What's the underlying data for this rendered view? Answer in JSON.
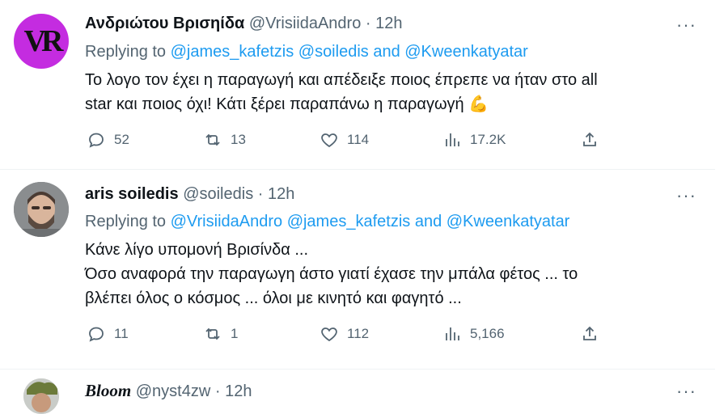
{
  "tweets": [
    {
      "name": "Ανδριώτου Βρισηίδα",
      "handle": "@VrisiidaAndro",
      "dot": "·",
      "time": "12h",
      "replying_prefix": "Replying to",
      "replying_mentions": "@james_kafetzis @soiledis and @Kweenkatyatar",
      "line1": "Το λογο τον έχει η παραγωγή και απέδειξε ποιος έπρεπε να ήταν στο all",
      "line2": "star και ποιος όχι! Κάτι ξέρει παραπάνω η παραγωγή 💪",
      "replies": "52",
      "retweets": "13",
      "likes": "114",
      "views": "17.2K"
    },
    {
      "name": "aris soiledis",
      "handle": "@soiledis",
      "dot": "·",
      "time": "12h",
      "replying_prefix": "Replying to",
      "replying_mentions": "@VrisiidaAndro @james_kafetzis and @Kweenkatyatar",
      "line1": "Κάνε λίγο υπομονή Βρισίνδα ...",
      "line2": "Όσο αναφορά την παραγωγη άστο γιατί έχασε την μπάλα φέτος ... το",
      "line3": "βλέπει όλος ο κόσμος ... όλοι με κινητό και φαγητό ...",
      "replies": "11",
      "retweets": "1",
      "likes": "112",
      "views": "5,166"
    },
    {
      "name": "Bloom",
      "handle": "@nyst4zw",
      "dot": "·",
      "time": "12h"
    }
  ],
  "avatar1_text": "VR",
  "more_label": "···"
}
